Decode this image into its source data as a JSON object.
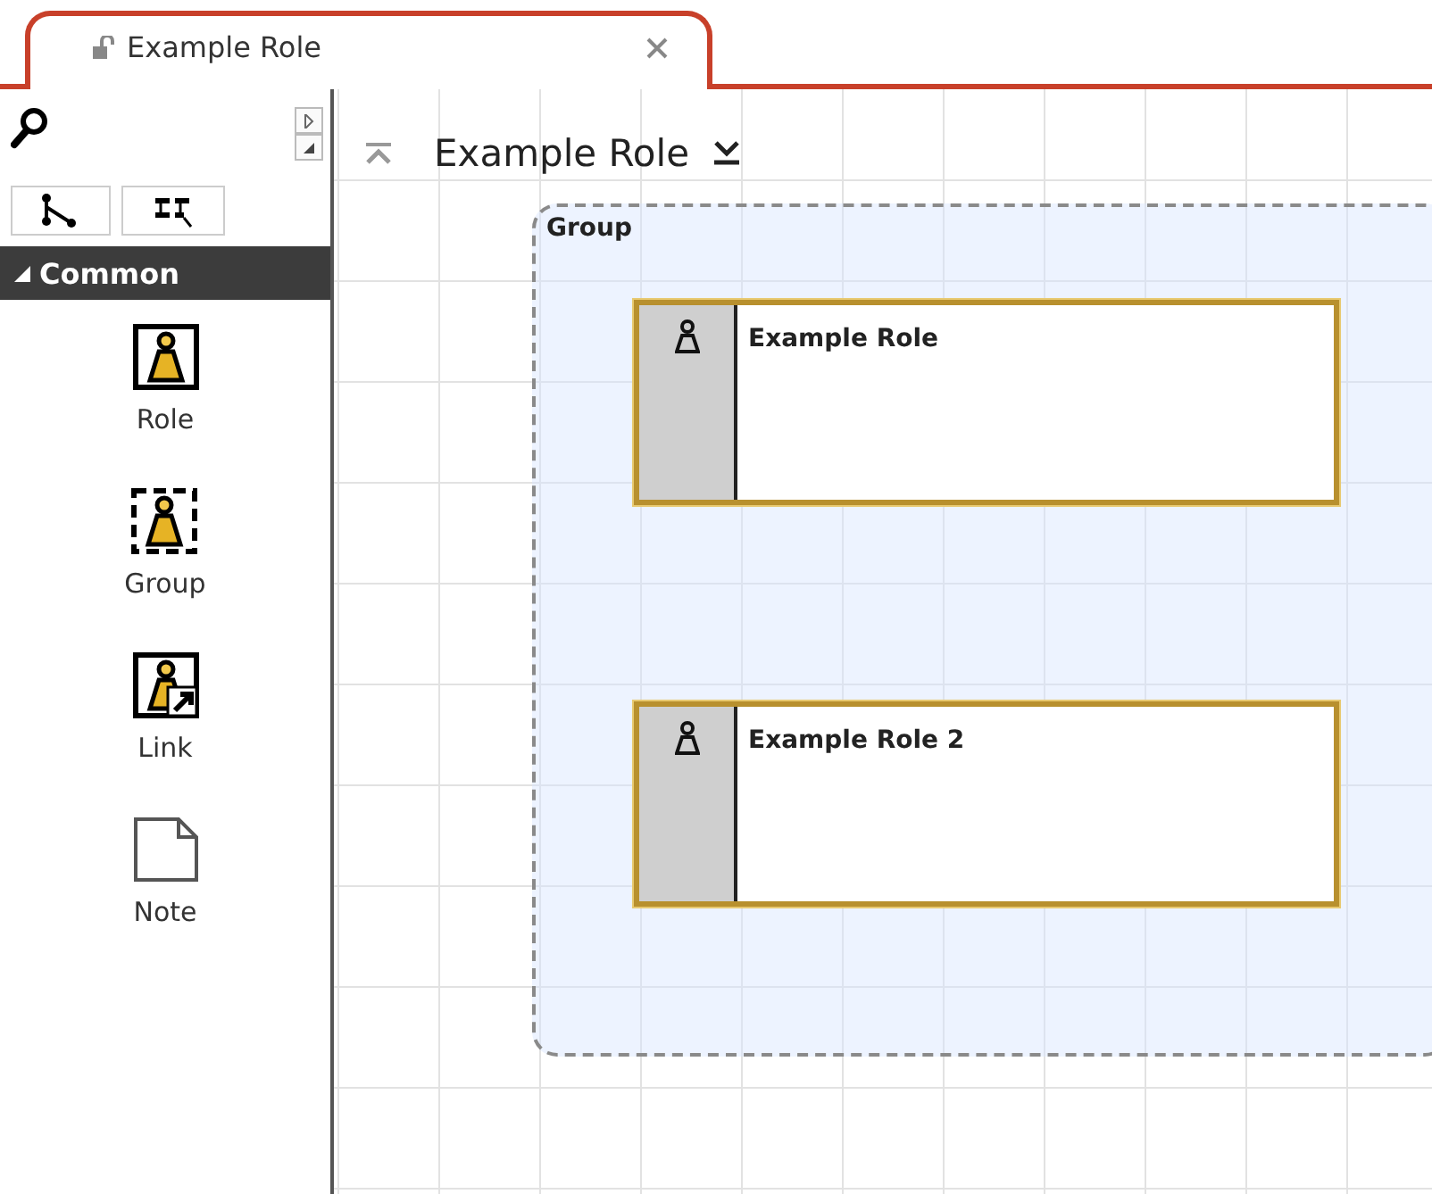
{
  "tab": {
    "title": "Example Role",
    "selected": true
  },
  "palette": {
    "category": {
      "label": "Common",
      "expanded": true
    },
    "items": [
      {
        "label": "Role",
        "kind": "role"
      },
      {
        "label": "Group",
        "kind": "group"
      },
      {
        "label": "Link",
        "kind": "link"
      },
      {
        "label": "Note",
        "kind": "note"
      }
    ]
  },
  "canvas": {
    "title": "Example Role",
    "group": {
      "label": "Group",
      "roles": [
        {
          "name": "Example Role"
        },
        {
          "name": "Example Role 2"
        }
      ]
    }
  }
}
